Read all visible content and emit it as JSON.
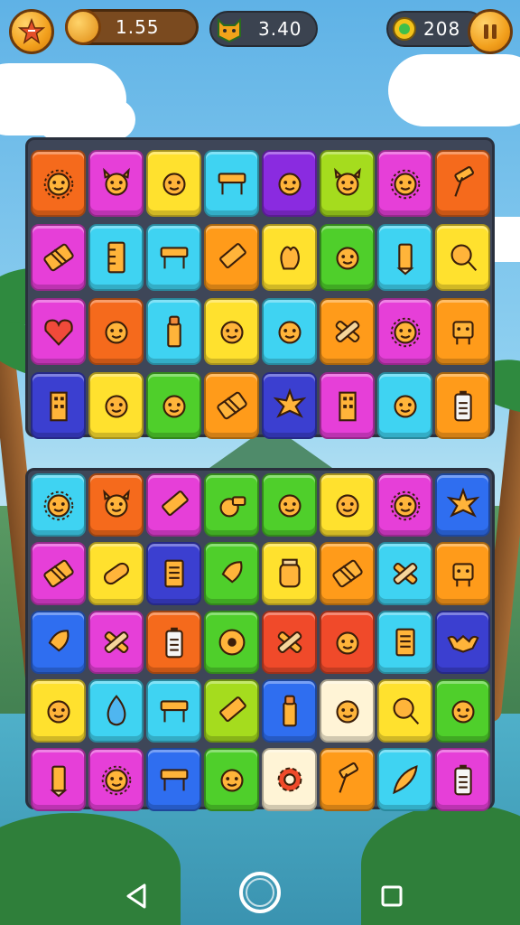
{
  "hud": {
    "level_icon": "star-badge-icon",
    "coins_value": "1.55",
    "coins_icon": "coin-icon",
    "score_value": "3.40",
    "score_icon": "cat-face-icon",
    "gems_value": "208",
    "gems_icon": "gem-icon",
    "pause_icon": "pause-icon"
  },
  "palette": {
    "orange": "#f56a1c",
    "magenta": "#e63fd8",
    "yellow": "#ffe12e",
    "cyan": "#3fd3f2",
    "purple": "#8a2be0",
    "green": "#4fcf2b",
    "lime": "#a5dc1e",
    "blue": "#2f6ef0",
    "amber": "#ff9b1a",
    "navy": "#3b3fd0",
    "cream": "#fff4d6",
    "red": "#f04a2a"
  },
  "board_top": {
    "rows": [
      [
        {
          "color": "orange",
          "icon": "sun-face-icon"
        },
        {
          "color": "magenta",
          "icon": "fox-face-icon"
        },
        {
          "color": "yellow",
          "icon": "smile-face-icon"
        },
        {
          "color": "cyan",
          "icon": "desk-icon"
        },
        {
          "color": "purple",
          "icon": "star-face-icon"
        },
        {
          "color": "lime",
          "icon": "cat-face-icon"
        },
        {
          "color": "magenta",
          "icon": "lion-face-icon"
        },
        {
          "color": "orange",
          "icon": "hammer-icon"
        }
      ],
      [
        {
          "color": "magenta",
          "icon": "eraser-icon"
        },
        {
          "color": "cyan",
          "icon": "ruler-icon"
        },
        {
          "color": "cyan",
          "icon": "desk-icon"
        },
        {
          "color": "amber",
          "icon": "crayon-icon"
        },
        {
          "color": "yellow",
          "icon": "hand-icon"
        },
        {
          "color": "green",
          "icon": "monster-face-icon"
        },
        {
          "color": "cyan",
          "icon": "pencil-icon"
        },
        {
          "color": "yellow",
          "icon": "magnifier-icon"
        }
      ],
      [
        {
          "color": "magenta",
          "icon": "heart-icon"
        },
        {
          "color": "orange",
          "icon": "bug-face-icon"
        },
        {
          "color": "cyan",
          "icon": "glue-stick-icon"
        },
        {
          "color": "yellow",
          "icon": "onion-face-icon"
        },
        {
          "color": "cyan",
          "icon": "seed-face-icon"
        },
        {
          "color": "amber",
          "icon": "cross-tool-icon"
        },
        {
          "color": "magenta",
          "icon": "lion-face-icon"
        },
        {
          "color": "amber",
          "icon": "robot-icon"
        }
      ],
      [
        {
          "color": "navy",
          "icon": "building-icon"
        },
        {
          "color": "yellow",
          "icon": "onion-face-icon"
        },
        {
          "color": "green",
          "icon": "acorn-face-icon"
        },
        {
          "color": "amber",
          "icon": "eraser-icon"
        },
        {
          "color": "navy",
          "icon": "splash-icon"
        },
        {
          "color": "magenta",
          "icon": "building-icon"
        },
        {
          "color": "cyan",
          "icon": "acorn-face-icon"
        },
        {
          "color": "amber",
          "icon": "battery-icon"
        }
      ]
    ]
  },
  "board_bottom": {
    "rows": [
      [
        {
          "color": "cyan",
          "icon": "sun-face-icon"
        },
        {
          "color": "orange",
          "icon": "fox-face-icon"
        },
        {
          "color": "magenta",
          "icon": "crayon-icon"
        },
        {
          "color": "green",
          "icon": "whistle-icon"
        },
        {
          "color": "green",
          "icon": "flame-face-icon"
        },
        {
          "color": "yellow",
          "icon": "pot-face-icon"
        },
        {
          "color": "magenta",
          "icon": "sun-face-icon"
        },
        {
          "color": "blue",
          "icon": "splash-icon"
        }
      ],
      [
        {
          "color": "magenta",
          "icon": "eraser-icon"
        },
        {
          "color": "yellow",
          "icon": "bandage-icon"
        },
        {
          "color": "navy",
          "icon": "notebook-icon"
        },
        {
          "color": "green",
          "icon": "rocket-icon"
        },
        {
          "color": "yellow",
          "icon": "jar-icon"
        },
        {
          "color": "amber",
          "icon": "eraser-icon"
        },
        {
          "color": "cyan",
          "icon": "cross-tool-icon"
        },
        {
          "color": "amber",
          "icon": "robot-icon"
        }
      ],
      [
        {
          "color": "blue",
          "icon": "rocket-icon"
        },
        {
          "color": "magenta",
          "icon": "cross-tool-icon"
        },
        {
          "color": "orange",
          "icon": "battery-icon"
        },
        {
          "color": "green",
          "icon": "donut-icon"
        },
        {
          "color": "red",
          "icon": "cross-tool-icon"
        },
        {
          "color": "red",
          "icon": "monster-face-icon"
        },
        {
          "color": "cyan",
          "icon": "notebook-icon"
        },
        {
          "color": "navy",
          "icon": "bat-icon"
        }
      ],
      [
        {
          "color": "yellow",
          "icon": "onion-face-icon"
        },
        {
          "color": "cyan",
          "icon": "drop-icon"
        },
        {
          "color": "cyan",
          "icon": "desk-icon"
        },
        {
          "color": "lime",
          "icon": "crayon-icon"
        },
        {
          "color": "blue",
          "icon": "glue-stick-icon"
        },
        {
          "color": "cream",
          "icon": "flame-face-icon"
        },
        {
          "color": "yellow",
          "icon": "magnifier-icon"
        },
        {
          "color": "green",
          "icon": "seed-face-icon"
        }
      ],
      [
        {
          "color": "magenta",
          "icon": "pencil-icon"
        },
        {
          "color": "magenta",
          "icon": "sun-face-icon"
        },
        {
          "color": "blue",
          "icon": "desk-icon"
        },
        {
          "color": "green",
          "icon": "flame-face-icon"
        },
        {
          "color": "cream",
          "icon": "gear-icon"
        },
        {
          "color": "amber",
          "icon": "hammer-icon"
        },
        {
          "color": "cyan",
          "icon": "feather-icon"
        },
        {
          "color": "magenta",
          "icon": "battery-icon"
        }
      ]
    ]
  },
  "nav": {
    "back_icon": "back-triangle-icon",
    "home_icon": "home-circle-icon",
    "recents_icon": "recents-square-icon"
  }
}
